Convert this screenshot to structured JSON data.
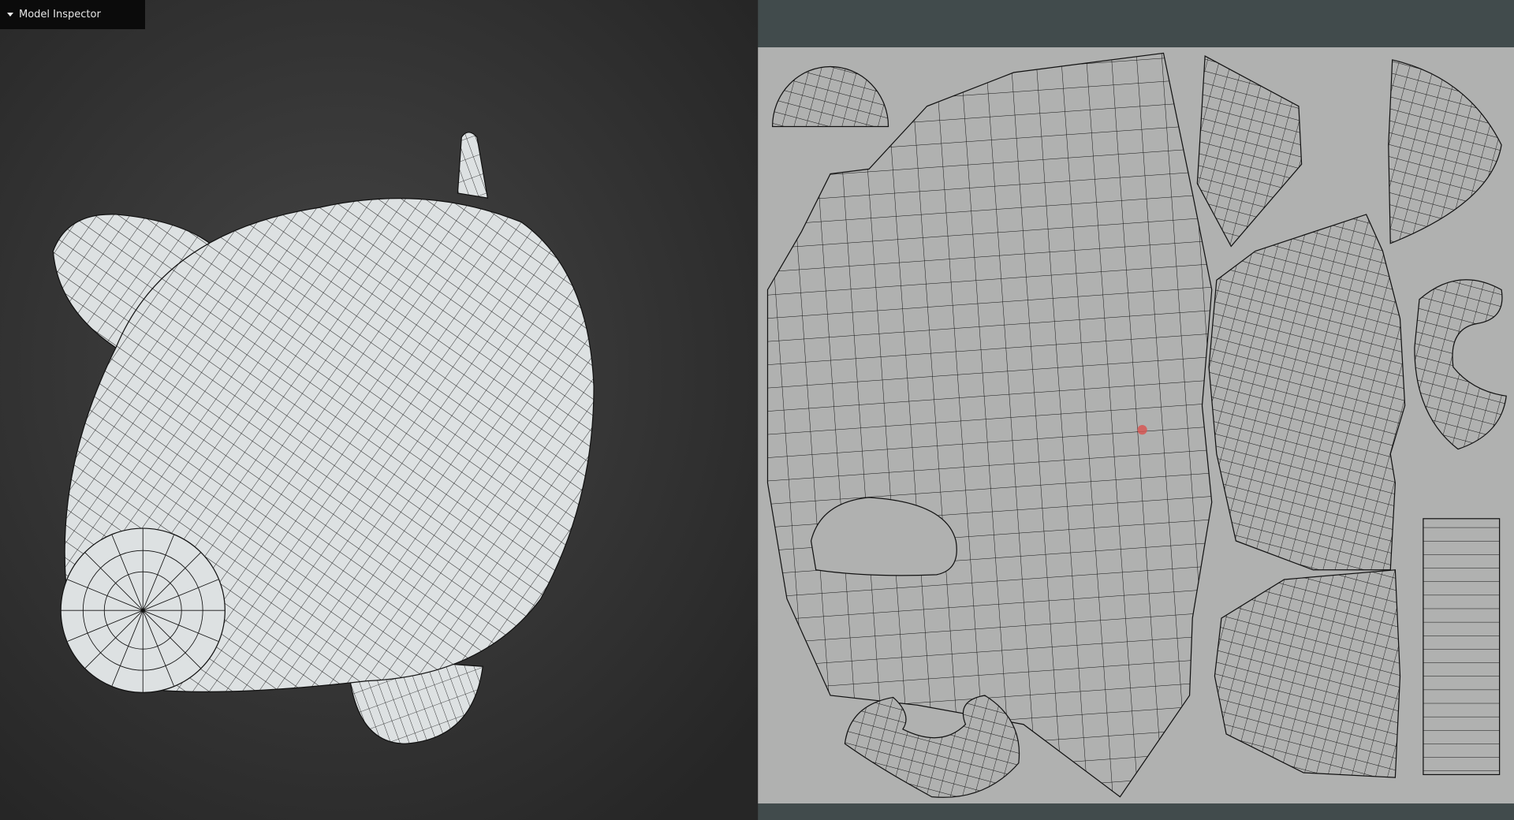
{
  "viewport": {
    "title": "Model Inspector",
    "collapse_icon": "caret-down-icon"
  },
  "colors": {
    "uv_background": "#b0b1b0",
    "uv_frame": "#414b4c",
    "viewport_bg": "#3a3a3a",
    "mesh_fill": "#dde1e2",
    "cursor_dot": "#d9534f"
  }
}
